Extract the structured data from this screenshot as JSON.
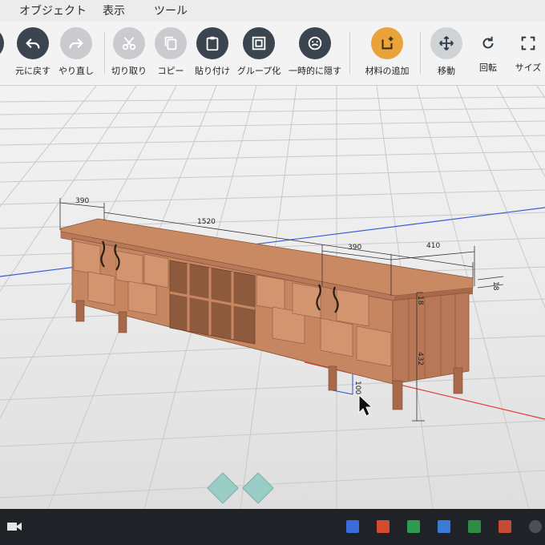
{
  "menu": {
    "items": [
      "オブジェクト",
      "表示",
      "ツール"
    ]
  },
  "toolbar": {
    "undo": "元に戻す",
    "redo": "やり直し",
    "cut": "切り取り",
    "copy": "コピー",
    "paste": "貼り付け",
    "group": "グループ化",
    "hide": "一時的に隠す",
    "add_material": "材料の追加",
    "move": "移動",
    "rotate": "回転",
    "size": "サイズ"
  },
  "dimensions": {
    "left_width": "390",
    "total_length": "1520",
    "right_width": "390",
    "depth": "410",
    "top_thickness": "18",
    "leg_height": "100",
    "body_height": "432",
    "side_thickness": "18"
  },
  "colors": {
    "wood": "#c98a63",
    "wood_dark": "#a8694a",
    "accent_orange": "#e8a33a",
    "grid_red_axis": "#e04040",
    "grid_blue_axis": "#3b5bd6"
  }
}
